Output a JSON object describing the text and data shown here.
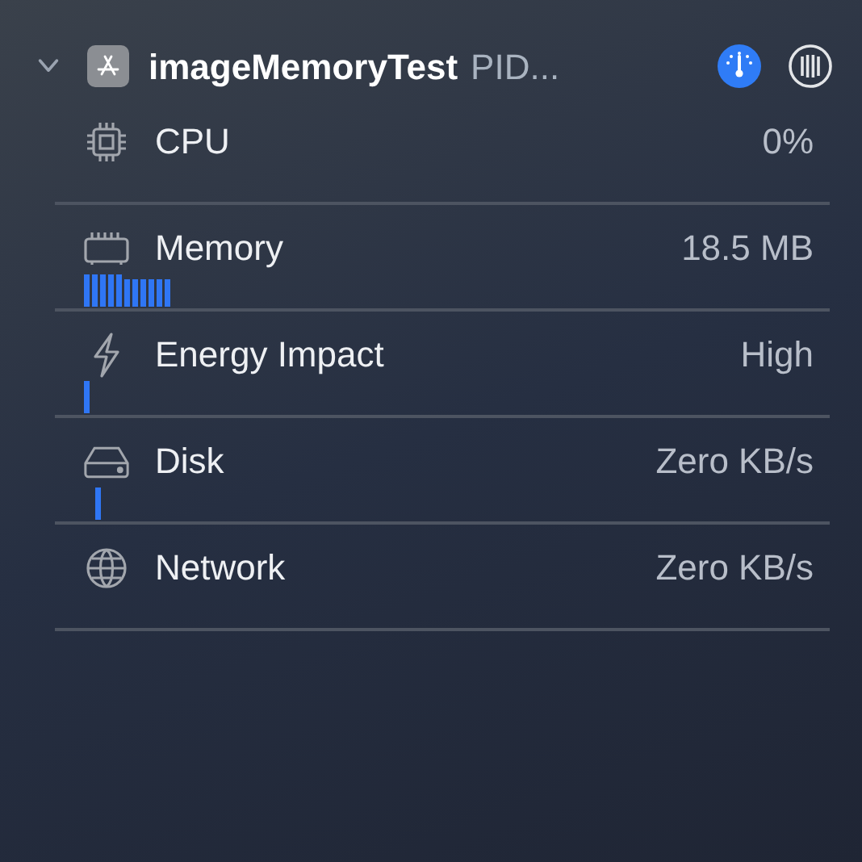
{
  "process": {
    "expanded": true,
    "name": "imageMemoryTest",
    "pid": "PID..."
  },
  "gauges": [
    {
      "kind": "cpu",
      "label": "CPU",
      "value": "0%"
    },
    {
      "kind": "memory",
      "label": "Memory",
      "value": "18.5 MB"
    },
    {
      "kind": "energy",
      "label": "Energy Impact",
      "value": "High"
    },
    {
      "kind": "disk",
      "label": "Disk",
      "value": "Zero KB/s"
    },
    {
      "kind": "network",
      "label": "Network",
      "value": "Zero KB/s"
    }
  ]
}
